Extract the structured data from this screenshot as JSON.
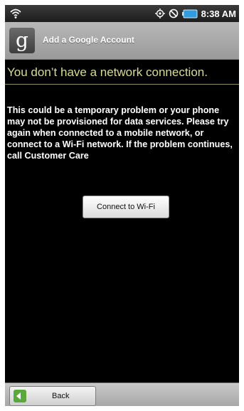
{
  "status_bar": {
    "time": "8:38 AM",
    "icons": [
      "wifi-icon",
      "gps-icon",
      "no-sound-icon",
      "battery-icon"
    ],
    "colors": {
      "battery": "#2f9de0",
      "bar": "#2b2b2b"
    }
  },
  "app_bar": {
    "title": "Add a Google Account",
    "logo_letter": "g"
  },
  "content": {
    "heading": "You don’t have a network connection.",
    "message": "This could be a temporary problem or your phone may not be provisioned for data services. Please try again when connected to a mobile network, or connect to a Wi-Fi network. If the problem continues, call Customer Care",
    "wifi_button_label": "Connect to Wi-Fi",
    "colors": {
      "heading": "#d8dc95",
      "background": "#000000"
    }
  },
  "footer": {
    "back_label": "Back",
    "back_icon": "arrow-left-icon",
    "colors": {
      "back_icon": "#5ca83b"
    }
  }
}
